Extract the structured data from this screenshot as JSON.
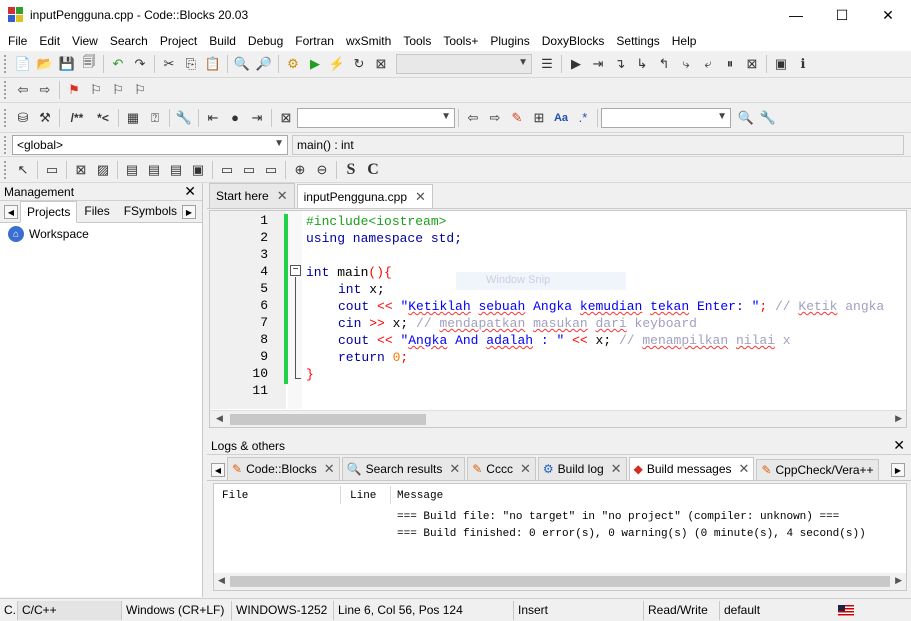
{
  "window": {
    "title": "inputPengguna.cpp - Code::Blocks 20.03",
    "minimize": "—",
    "maximize": "☐",
    "close": "✕"
  },
  "menu": [
    "File",
    "Edit",
    "View",
    "Search",
    "Project",
    "Build",
    "Debug",
    "Fortran",
    "wxSmith",
    "Tools",
    "Tools+",
    "Plugins",
    "DoxyBlocks",
    "Settings",
    "Help"
  ],
  "toolbar": {
    "doxy_comment": "/**",
    "doxy_line": "*<",
    "search_text_icon": "Aa",
    "regex_icon": ".*",
    "bold_s": "S",
    "bold_c": "C"
  },
  "scope": {
    "global": "<global>",
    "function": "main() : int"
  },
  "management": {
    "title": "Management",
    "tabs": [
      "Projects",
      "Files",
      "FSymbols"
    ],
    "workspace": "Workspace"
  },
  "editor": {
    "tabs": [
      "Start here",
      "inputPengguna.cpp"
    ],
    "line_numbers": [
      "1",
      "2",
      "3",
      "4",
      "5",
      "6",
      "7",
      "8",
      "9",
      "10",
      "11"
    ],
    "overlay": "Window Snip",
    "code": {
      "l1": "#include<iostream>",
      "l2_kw": "using namespace",
      "l2_rest": " std;",
      "l4_kw": "int",
      "l4_rest": " main",
      "l4_paren": "(){",
      "l5_kw": "int",
      "l5_rest": " x;",
      "l6_cout": "cout",
      "l6_op": " << ",
      "l6_str_a": "\"",
      "l6_w1": "Ketiklah",
      "l6_s1": " ",
      "l6_w2": "sebuah",
      "l6_s2": " Angka ",
      "l6_w3": "kemudian",
      "l6_s3": " ",
      "l6_w4": "tekan",
      "l6_s4": " Enter: \"",
      "l6_semi": "; ",
      "l6_cmt_a": "// ",
      "l6_cw1": "Ketik",
      "l6_cmt_b": " ",
      "l6_cw2": "angka",
      "l7_cin": "cin",
      "l7_op": " >> ",
      "l7_x": "x; ",
      "l7_cmt_a": "// ",
      "l7_cw1": "mendapatkan",
      "l7_cmt_b": " ",
      "l7_cw2": "masukan",
      "l7_cmt_c": " ",
      "l7_cw3": "dari",
      "l7_cmt_d": " keyboard",
      "l8_cout": "cout",
      "l8_op": " << ",
      "l8_str_a": "\"",
      "l8_w1": "Angka",
      "l8_s1": " And ",
      "l8_w2": "adalah",
      "l8_s2": " : \"",
      "l8_op2": " << ",
      "l8_x": "x; ",
      "l8_cmt_a": "// ",
      "l8_cw1": "menampilkan",
      "l8_cmt_b": " ",
      "l8_cw2": "nilai",
      "l8_cmt_c": " x",
      "l9_kw": "return",
      "l9_num": " 0",
      "l9_semi": ";",
      "l10": "}"
    }
  },
  "logs": {
    "title": "Logs & others",
    "tabs": [
      "Code::Blocks",
      "Search results",
      "Cccc",
      "Build log",
      "Build messages",
      "CppCheck/Vera++"
    ],
    "columns": [
      "File",
      "Line",
      "Message"
    ],
    "messages": [
      "=== Build file: \"no target\" in \"no project\" (compiler: unknown) ===",
      "=== Build finished: 0 error(s), 0 warning(s) (0 minute(s), 4 second(s))"
    ]
  },
  "status": {
    "c": "C...",
    "lang": "C/C++",
    "eol": "Windows (CR+LF)",
    "encoding": "WINDOWS-1252",
    "position": "Line 6, Col 56, Pos 124",
    "mode": "Insert",
    "rw": "Read/Write",
    "profile": "default"
  },
  "colors": {
    "change_bar": "#1fd24a",
    "preprocessor": "#1a9e1a",
    "keyword": "#0000a0",
    "string": "#0000ff",
    "number": "#f07800",
    "operator": "#ff0000",
    "comment": "#a0a0c0"
  }
}
